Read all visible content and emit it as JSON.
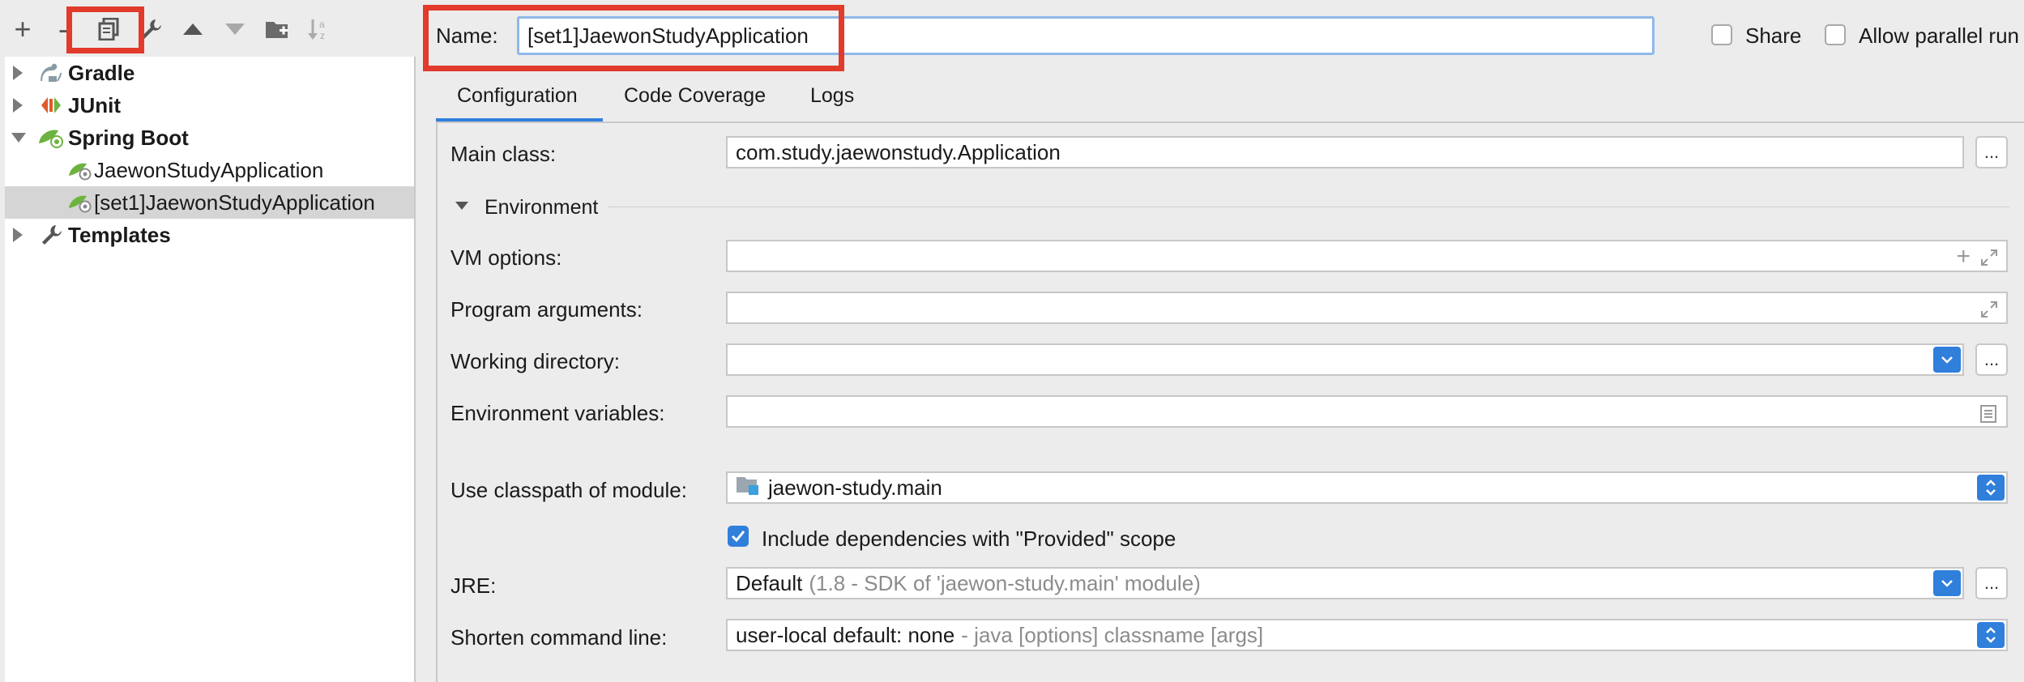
{
  "toolbar": {
    "buttons": [
      "add-icon",
      "remove-icon",
      "copy-icon",
      "wrench-icon",
      "move-up-icon",
      "move-down-icon",
      "new-folder-icon",
      "sort-icon"
    ],
    "add_glyph": "+",
    "remove_glyph": "-"
  },
  "tree": {
    "gradle": "Gradle",
    "junit": "JUnit",
    "spring_boot": "Spring Boot",
    "app1": "JaewonStudyApplication",
    "app2": "[set1]JaewonStudyApplication",
    "templates": "Templates"
  },
  "header": {
    "name_label": "Name:",
    "name_value": "[set1]JaewonStudyApplication",
    "share_label": "Share",
    "allow_parallel_label": "Allow parallel run"
  },
  "tabs": [
    "Configuration",
    "Code Coverage",
    "Logs"
  ],
  "form": {
    "main_class_label": "Main class:",
    "main_class_value": "com.study.jaewonstudy.Application",
    "environment_section": "Environment",
    "vm_options_label": "VM options:",
    "program_args_label": "Program arguments:",
    "working_dir_label": "Working directory:",
    "env_vars_label": "Environment variables:",
    "classpath_label": "Use classpath of module:",
    "classpath_value": "jaewon-study.main",
    "include_deps_label": "Include dependencies with \"Provided\" scope",
    "jre_label": "JRE:",
    "jre_value": "Default",
    "jre_hint": "(1.8 - SDK of 'jaewon-study.main' module)",
    "shorten_label": "Shorten command line:",
    "shorten_value": "user-local default: none",
    "shorten_hint": "- java [options] classname [args]",
    "ellipsis": "..."
  },
  "colors": {
    "accent": "#2f7fdb",
    "highlight_box": "#e23a2b",
    "selection": "#d5d5d5",
    "spring_green": "#6db33f"
  }
}
